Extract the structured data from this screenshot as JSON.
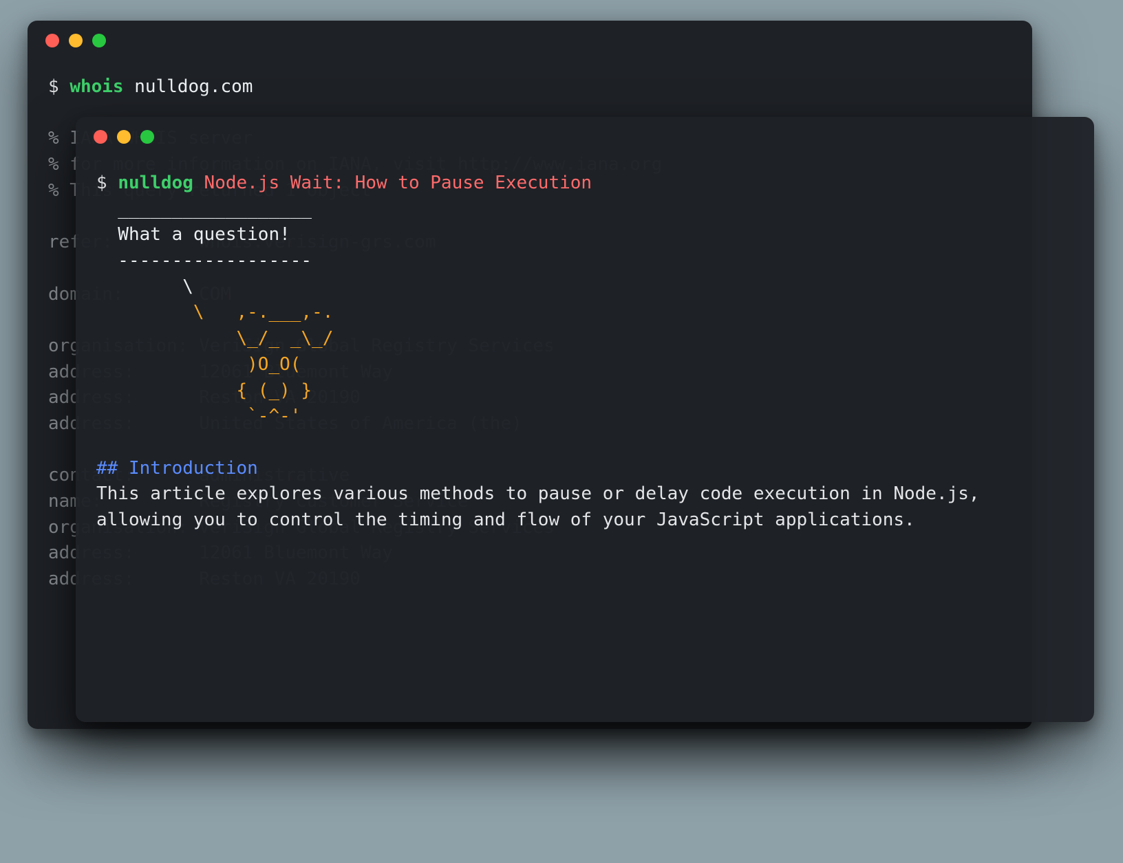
{
  "back": {
    "prompt_symbol": "$",
    "command": "whois",
    "arg": "nulldog.com",
    "lines": [
      "% IANA WHOIS server",
      "% for more information on IANA, visit http://www.iana.org",
      "% This query returned 1 object",
      "",
      "refer:        whois.verisign-grs.com",
      "",
      "domain:       COM",
      "",
      "organisation: VeriSign Global Registry Services",
      "address:      12061 Bluemont Way",
      "address:      Reston VA 20190",
      "address:      United States of America (the)",
      "",
      "contact:      administrative",
      "name:         Registry Customer Service",
      "organisation: VeriSign Global Registry Services",
      "address:      12061 Bluemont Way",
      "address:      Reston VA 20190"
    ]
  },
  "front": {
    "prompt_symbol": "$",
    "command": "nulldog",
    "title": "Node.js Wait: How to Pause Execution",
    "speech_top": "  __________________",
    "speech_mid": "  What a question!",
    "speech_bot": "  ------------------",
    "dog_line1": "        \\",
    "dog_line2": "         \\   ,-.___,-.",
    "dog_line3": "             \\_/_ _\\_/",
    "dog_line4": "              )O_O(",
    "dog_line5": "             { (_) }",
    "dog_line6": "              `-^-'",
    "heading": "## Introduction",
    "body": "This article explores various methods to pause or delay code execution in Node.js, allowing you to control the timing and flow of your JavaScript applications."
  }
}
